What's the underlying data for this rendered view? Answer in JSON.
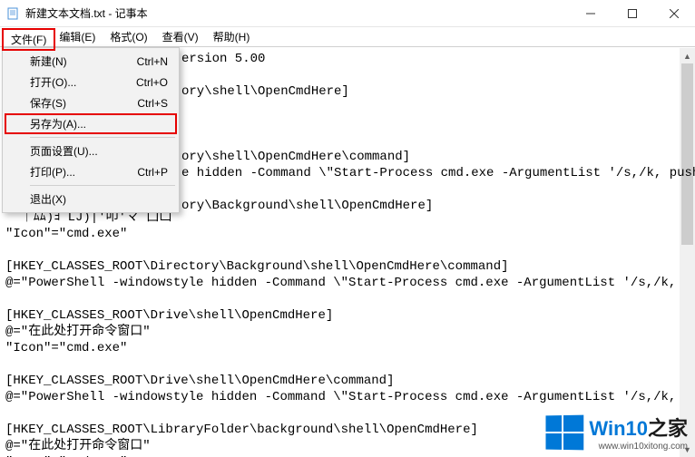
{
  "titlebar": {
    "title": "新建文本文档.txt - 记事本"
  },
  "menubar": {
    "file": "文件(F)",
    "edit": "编辑(E)",
    "format": "格式(O)",
    "view": "查看(V)",
    "help": "帮助(H)"
  },
  "file_menu": {
    "new": {
      "label": "新建(N)",
      "shortcut": "Ctrl+N"
    },
    "open": {
      "label": "打开(O)...",
      "shortcut": "Ctrl+O"
    },
    "save": {
      "label": "保存(S)",
      "shortcut": "Ctrl+S"
    },
    "saveas": {
      "label": "另存为(A)...",
      "shortcut": ""
    },
    "pagesetup": {
      "label": "页面设置(U)...",
      "shortcut": ""
    },
    "print": {
      "label": "打印(P)...",
      "shortcut": "Ctrl+P"
    },
    "exit": {
      "label": "退出(X)",
      "shortcut": ""
    }
  },
  "editor": {
    "visible_right_of_menu": "ersion 5.00\n\nory\\shell\\OpenCmdHere]\n\n\n\nory\\shell\\OpenCmdHere\\command]\ne hidden -Command \\\"Start-Process cmd.exe -ArgumentList '/s,/k, push\n\nory\\Background\\shell\\OpenCmdHere]",
    "below_menu": "  ｜ﾑﾑ)ﾖ LJ)|'叩'マ 囗凵\n\"Icon\"=\"cmd.exe\"\n\n[HKEY_CLASSES_ROOT\\Directory\\Background\\shell\\OpenCmdHere\\command]\n@=\"PowerShell -windowstyle hidden -Command \\\"Start-Process cmd.exe -ArgumentList '/s,/k, push\n\n[HKEY_CLASSES_ROOT\\Drive\\shell\\OpenCmdHere]\n@=\"在此处打开命令窗口\"\n\"Icon\"=\"cmd.exe\"\n\n[HKEY_CLASSES_ROOT\\Drive\\shell\\OpenCmdHere\\command]\n@=\"PowerShell -windowstyle hidden -Command \\\"Start-Process cmd.exe -ArgumentList '/s,/k, push\n\n[HKEY_CLASSES_ROOT\\LibraryFolder\\background\\shell\\OpenCmdHere]\n@=\"在此处打开命令窗口\"\n\"Icon\"=\"cmd.exe\"\n\n[HKEY_CLASSES_ROOT\\LibraryFolder\\background\\shell\\OpenCmdHere\\command]"
  },
  "watermark": {
    "main_a": "Win10",
    "main_b": "之家",
    "sub": "www.win10xitong.com"
  }
}
